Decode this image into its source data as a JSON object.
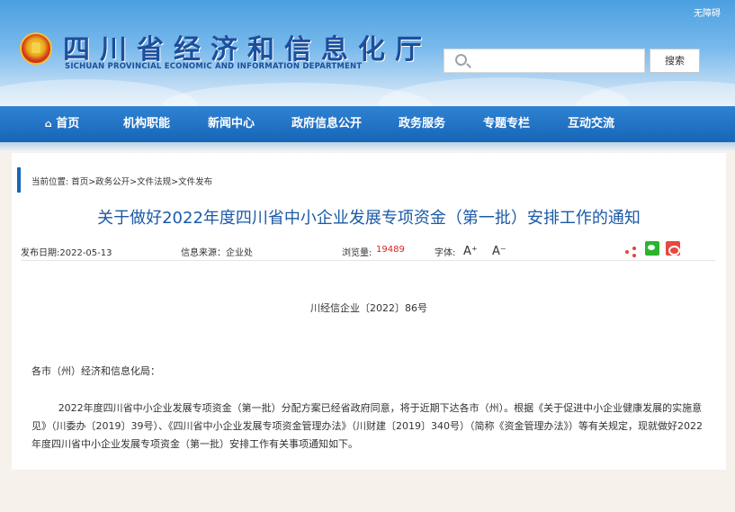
{
  "header": {
    "accessibility_label": "无障碍",
    "site_title_cn": "四川省经济和信息化厅",
    "site_title_en": "SICHUAN PROVINCIAL ECONOMIC AND INFORMATION DEPARTMENT",
    "search": {
      "placeholder": "",
      "button_label": "搜索"
    }
  },
  "nav": {
    "items": [
      {
        "label": "首页",
        "icon": "home-icon"
      },
      {
        "label": "机构职能"
      },
      {
        "label": "新闻中心"
      },
      {
        "label": "政府信息公开"
      },
      {
        "label": "政务服务"
      },
      {
        "label": "专题专栏"
      },
      {
        "label": "互动交流"
      }
    ]
  },
  "breadcrumb": "当前位置: 首页>政务公开>文件法规>文件发布",
  "article": {
    "title": "关于做好2022年度四川省中小企业发展专项资金（第一批）安排工作的通知",
    "meta": {
      "publish_date": "发布日期:2022-05-13",
      "source": "信息来源：企业处",
      "views_label": "浏览量:",
      "views_value": "19489",
      "font_label": "字体:",
      "font_increase": "A⁺",
      "font_decrease": "A⁻"
    },
    "doc_number": "川经信企业〔2022〕86号",
    "addressee": "各市（州）经济和信息化局：",
    "paragraph": "2022年度四川省中小企业发展专项资金（第一批）分配方案已经省政府同意，将于近期下达各市（州）。根据《关于促进中小企业健康发展的实施意见》（川委办〔2019〕39号）、《四川省中小企业发展专项资金管理办法》（川财建〔2019〕340号）（简称《资金管理办法》）等有关规定，现就做好2022年度四川省中小企业发展专项资金（第一批）安排工作有关事项通知如下。"
  },
  "colors": {
    "nav_blue": "#1766b8",
    "title_blue": "#1a5aa8",
    "views_red": "#d9241f"
  }
}
